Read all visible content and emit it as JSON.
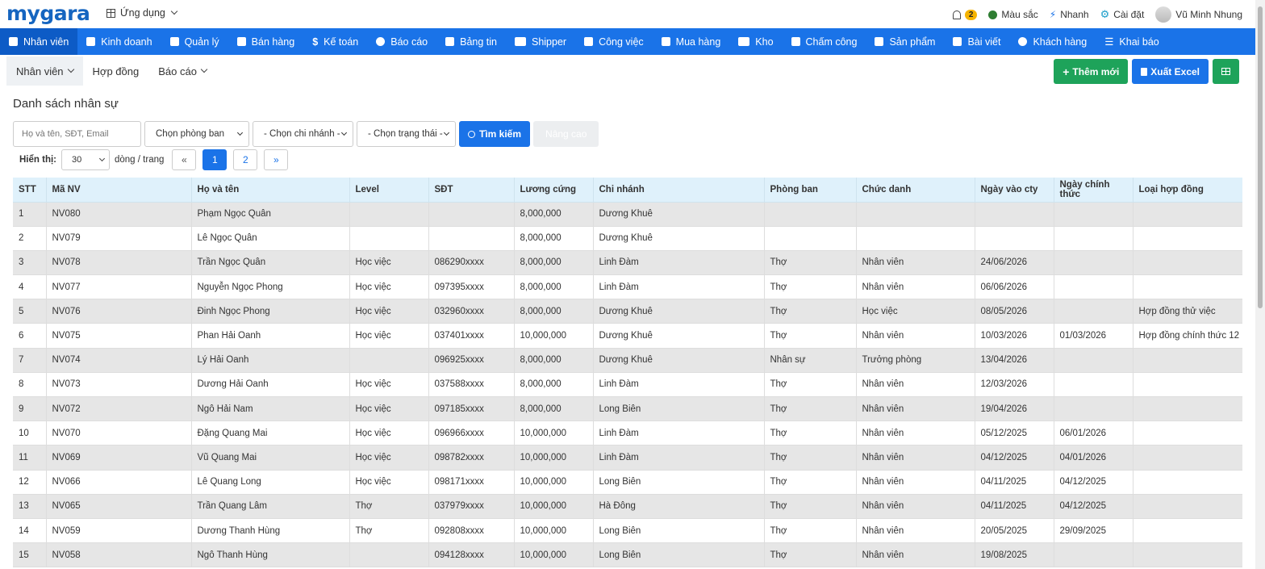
{
  "topbar": {
    "logo": "mygara",
    "apps_label": "Ứng dụng",
    "notifications_count": "2",
    "color_label": "Màu sắc",
    "quick_label": "Nhanh",
    "settings_label": "Cài đặt",
    "user_name": "Vũ Minh Nhung"
  },
  "nav": [
    {
      "label": "Nhân viên",
      "icon": "user-icon"
    },
    {
      "label": "Kinh doanh",
      "icon": "briefcase-icon"
    },
    {
      "label": "Quản lý",
      "icon": "id-card-icon"
    },
    {
      "label": "Bán hàng",
      "icon": "cart-icon"
    },
    {
      "label": "Kế toán",
      "icon": "dollar-icon"
    },
    {
      "label": "Báo cáo",
      "icon": "pie-chart-icon"
    },
    {
      "label": "Bảng tin",
      "icon": "home-icon"
    },
    {
      "label": "Shipper",
      "icon": "truck-icon"
    },
    {
      "label": "Công việc",
      "icon": "calendar-icon"
    },
    {
      "label": "Mua hàng",
      "icon": "basket-icon"
    },
    {
      "label": "Kho",
      "icon": "warehouse-icon"
    },
    {
      "label": "Chấm công",
      "icon": "calendar-check-icon"
    },
    {
      "label": "Sản phẩm",
      "icon": "box-icon"
    },
    {
      "label": "Bài viết",
      "icon": "book-icon"
    },
    {
      "label": "Khách hàng",
      "icon": "smile-icon"
    },
    {
      "label": "Khai báo",
      "icon": "list-icon"
    }
  ],
  "subnav": {
    "tabs": [
      "Nhân viên",
      "Hợp đồng",
      "Báo cáo"
    ],
    "add_label": "Thêm mới",
    "export_label": "Xuất Excel"
  },
  "page_title": "Danh sách nhân sự",
  "filters": {
    "search_placeholder": "Họ và tên, SĐT, Email",
    "department": "Chọn phòng ban",
    "branch": "- Chọn chi nhánh -",
    "status": "- Chọn trạng thái -",
    "search_label": "Tìm kiếm",
    "advanced_label": "Nâng cao"
  },
  "paging": {
    "show_label": "Hiển thị:",
    "page_size": "30",
    "per_page_label": "dòng / trang",
    "first": "«",
    "pages": [
      "1",
      "2"
    ],
    "last": "»"
  },
  "table": {
    "columns": [
      "STT",
      "Mã NV",
      "Họ và tên",
      "Level",
      "SĐT",
      "Lương cứng",
      "Chi nhánh",
      "Phòng ban",
      "Chức danh",
      "Ngày vào cty",
      "Ngày chính thức",
      "Loại hợp đồng"
    ],
    "rows": [
      [
        "1",
        "NV080",
        "Phạm Ngọc Quân",
        "",
        "",
        "8,000,000",
        "Dương Khuê",
        "",
        "",
        "",
        "",
        ""
      ],
      [
        "2",
        "NV079",
        "Lê Ngọc Quân",
        "",
        "",
        "8,000,000",
        "Dương Khuê",
        "",
        "",
        "",
        "",
        ""
      ],
      [
        "3",
        "NV078",
        "Trần Ngọc Quân",
        "Học việc",
        "086290xxxx",
        "8,000,000",
        "Linh Đàm",
        "Thợ",
        "Nhân viên",
        "24/06/2026",
        "",
        ""
      ],
      [
        "4",
        "NV077",
        "Nguyễn Ngọc Phong",
        "Học việc",
        "097395xxxx",
        "8,000,000",
        "Linh Đàm",
        "Thợ",
        "Nhân viên",
        "06/06/2026",
        "",
        ""
      ],
      [
        "5",
        "NV076",
        "Đinh Ngọc Phong",
        "Học việc",
        "032960xxxx",
        "8,000,000",
        "Dương Khuê",
        "Thợ",
        "Học việc",
        "08/05/2026",
        "",
        "Hợp đồng thử việc"
      ],
      [
        "6",
        "NV075",
        "Phan Hải Oanh",
        "Học việc",
        "037401xxxx",
        "10,000,000",
        "Dương Khuê",
        "Thợ",
        "Nhân viên",
        "10/03/2026",
        "01/03/2026",
        "Hợp đồng chính thức 12"
      ],
      [
        "7",
        "NV074",
        "Lý Hải Oanh",
        "",
        "096925xxxx",
        "8,000,000",
        "Dương Khuê",
        "Nhân sự",
        "Trưởng phòng",
        "13/04/2026",
        "",
        ""
      ],
      [
        "8",
        "NV073",
        "Dương Hải Oanh",
        "Học việc",
        "037588xxxx",
        "8,000,000",
        "Linh Đàm",
        "Thợ",
        "Nhân viên",
        "12/03/2026",
        "",
        ""
      ],
      [
        "9",
        "NV072",
        "Ngô Hải Nam",
        "Học việc",
        "097185xxxx",
        "8,000,000",
        "Long Biên",
        "Thợ",
        "Nhân viên",
        "19/04/2026",
        "",
        ""
      ],
      [
        "10",
        "NV070",
        "Đặng Quang Mai",
        "Học việc",
        "096966xxxx",
        "10,000,000",
        "Linh Đàm",
        "Thợ",
        "Nhân viên",
        "05/12/2025",
        "06/01/2026",
        ""
      ],
      [
        "11",
        "NV069",
        "Vũ Quang Mai",
        "Học việc",
        "098782xxxx",
        "10,000,000",
        "Linh Đàm",
        "Thợ",
        "Nhân viên",
        "04/12/2025",
        "04/01/2026",
        ""
      ],
      [
        "12",
        "NV066",
        "Lê Quang Long",
        "Học việc",
        "098171xxxx",
        "10,000,000",
        "Long Biên",
        "Thợ",
        "Nhân viên",
        "04/11/2025",
        "04/12/2025",
        ""
      ],
      [
        "13",
        "NV065",
        "Trần Quang Lâm",
        "Thợ",
        "037979xxxx",
        "10,000,000",
        "Hà Đông",
        "Thợ",
        "Nhân viên",
        "04/11/2025",
        "04/12/2025",
        ""
      ],
      [
        "14",
        "NV059",
        "Dương Thanh Hùng",
        "Thợ",
        "092808xxxx",
        "10,000,000",
        "Long Biên",
        "Thợ",
        "Nhân viên",
        "20/05/2025",
        "29/09/2025",
        ""
      ],
      [
        "15",
        "NV058",
        "Ngô Thanh Hùng",
        "",
        "094128xxxx",
        "10,000,000",
        "Long Biên",
        "Thợ",
        "Nhân viên",
        "19/08/2025",
        "",
        ""
      ]
    ]
  },
  "colors": {
    "brand": "#1565c0",
    "nav_bg": "#1a73e8",
    "primary_button": "#1a73e8",
    "success_button": "#1ea35a",
    "table_header": "#dff1fb",
    "row_stripe": "#e6e6e6"
  }
}
